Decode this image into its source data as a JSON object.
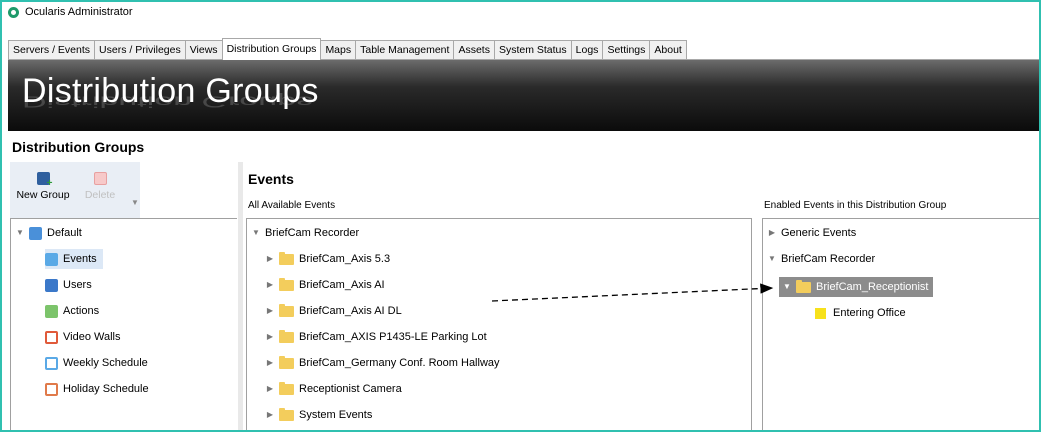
{
  "window": {
    "title": "Ocularis Administrator"
  },
  "tabs": [
    "Servers / Events",
    "Users / Privileges",
    "Views",
    "Distribution Groups",
    "Maps",
    "Table Management",
    "Assets",
    "System Status",
    "Logs",
    "Settings",
    "About"
  ],
  "active_tab": "Distribution Groups",
  "banner": {
    "title": "Distribution Groups"
  },
  "section_title": "Distribution Groups",
  "toolbar": {
    "new_group": "New Group",
    "delete": "Delete"
  },
  "left_tree": {
    "root": "Default",
    "children": [
      "Events",
      "Users",
      "Actions",
      "Video Walls",
      "Weekly Schedule",
      "Holiday Schedule"
    ],
    "selected": "Events"
  },
  "events": {
    "title": "Events",
    "available_label": "All Available Events",
    "enabled_label": "Enabled Events in this Distribution Group",
    "available_root": "BriefCam Recorder",
    "available_items": [
      "BriefCam_Axis 5.3",
      "BriefCam_Axis AI",
      "BriefCam_Axis AI DL",
      "BriefCam_AXIS P1435-LE Parking Lot",
      "BriefCam_Germany Conf. Room Hallway",
      "Receptionist Camera",
      "System Events"
    ],
    "enabled_items": [
      "Generic Events",
      "BriefCam Recorder"
    ],
    "enabled_folder": "BriefCam_Receptionist",
    "enabled_leaf": "Entering Office"
  },
  "colors": {
    "accent_frame": "#30c0b0",
    "banner_bg": "#0b0b0b",
    "selection": "#dce8f6",
    "highlight": "#8c8c8c",
    "event_leaf": "#f7e11b"
  }
}
